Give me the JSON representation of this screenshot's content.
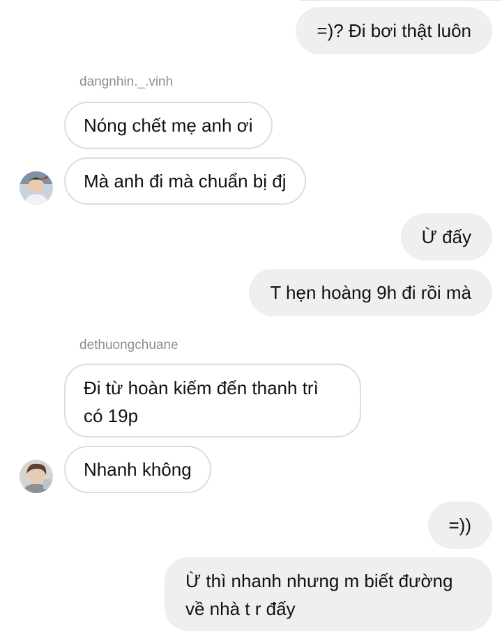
{
  "messages": [
    {
      "direction": "outgoing",
      "text": "=)? Đi bơi thật luôn"
    },
    {
      "direction": "incoming",
      "sender": "dangnhin._.vinh",
      "text": "Nóng chết mẹ anh ơi"
    },
    {
      "direction": "incoming",
      "sender": "dangnhin._.vinh",
      "text": "Mà anh đi mà chuẩn bị đj"
    },
    {
      "direction": "outgoing",
      "text": "Ừ đấy"
    },
    {
      "direction": "outgoing",
      "text": "T hẹn hoàng 9h đi rồi mà"
    },
    {
      "direction": "incoming",
      "sender": "dethuongchuane",
      "text": "Đi từ hoàn kiếm đến thanh trì\ncó 19p"
    },
    {
      "direction": "incoming",
      "sender": "dethuongchuane",
      "text": "Nhanh không"
    },
    {
      "direction": "outgoing",
      "text": "=))"
    },
    {
      "direction": "outgoing",
      "text": "Ừ thì nhanh nhưng m biết đường\nvề nhà t r đấy"
    }
  ],
  "colors": {
    "outgoing_bubble": "#efefef",
    "incoming_border": "#dcdcdc",
    "sender_name": "#8e8e8e",
    "text": "#111111"
  },
  "avatars": [
    {
      "name": "avatar-dangnhin-vinh",
      "icon": "user-photo-icon"
    },
    {
      "name": "avatar-dethuongchuane",
      "icon": "user-photo-icon"
    }
  ]
}
